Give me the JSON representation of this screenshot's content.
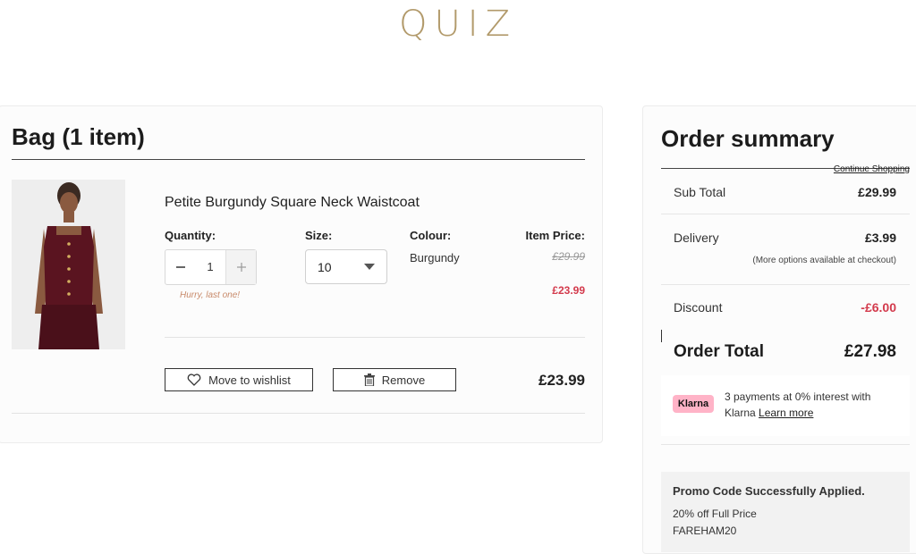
{
  "brand": {
    "logo_text": "QUIZ"
  },
  "bag": {
    "title": "Bag (1 item)",
    "item": {
      "name": "Petite Burgundy Square Neck Waistcoat",
      "quantity_label": "Quantity:",
      "quantity_value": "1",
      "stock_note": "Hurry, last one!",
      "size_label": "Size:",
      "size_value": "10",
      "colour_label": "Colour:",
      "colour_value": "Burgundy",
      "price_label": "Item Price:",
      "original_price": "£29.99",
      "sale_price": "£23.99",
      "line_total": "£23.99",
      "wishlist_label": "Move to wishlist",
      "remove_label": "Remove"
    }
  },
  "summary": {
    "title": "Order summary",
    "continue_label": "Continue Shopping",
    "subtotal_label": "Sub Total",
    "subtotal_value": "£29.99",
    "delivery_label": "Delivery",
    "delivery_value": "£3.99",
    "delivery_note": "(More options available at checkout)",
    "discount_label": "Discount",
    "discount_value": "-£6.00",
    "total_label": "Order Total",
    "total_value": "£27.98",
    "klarna_badge": "Klarna",
    "klarna_text": "3 payments at 0% interest with Klarna",
    "klarna_link": "Learn more"
  },
  "promo": {
    "title": "Promo Code Successfully Applied.",
    "description": "20% off Full Price",
    "code": "FAREHAM20"
  },
  "colors": {
    "accent_gold": "#b29a6b",
    "sale_red": "#d33a4c",
    "product_burgundy": "#5a1420",
    "klarna_pink": "#ffb3c7"
  }
}
